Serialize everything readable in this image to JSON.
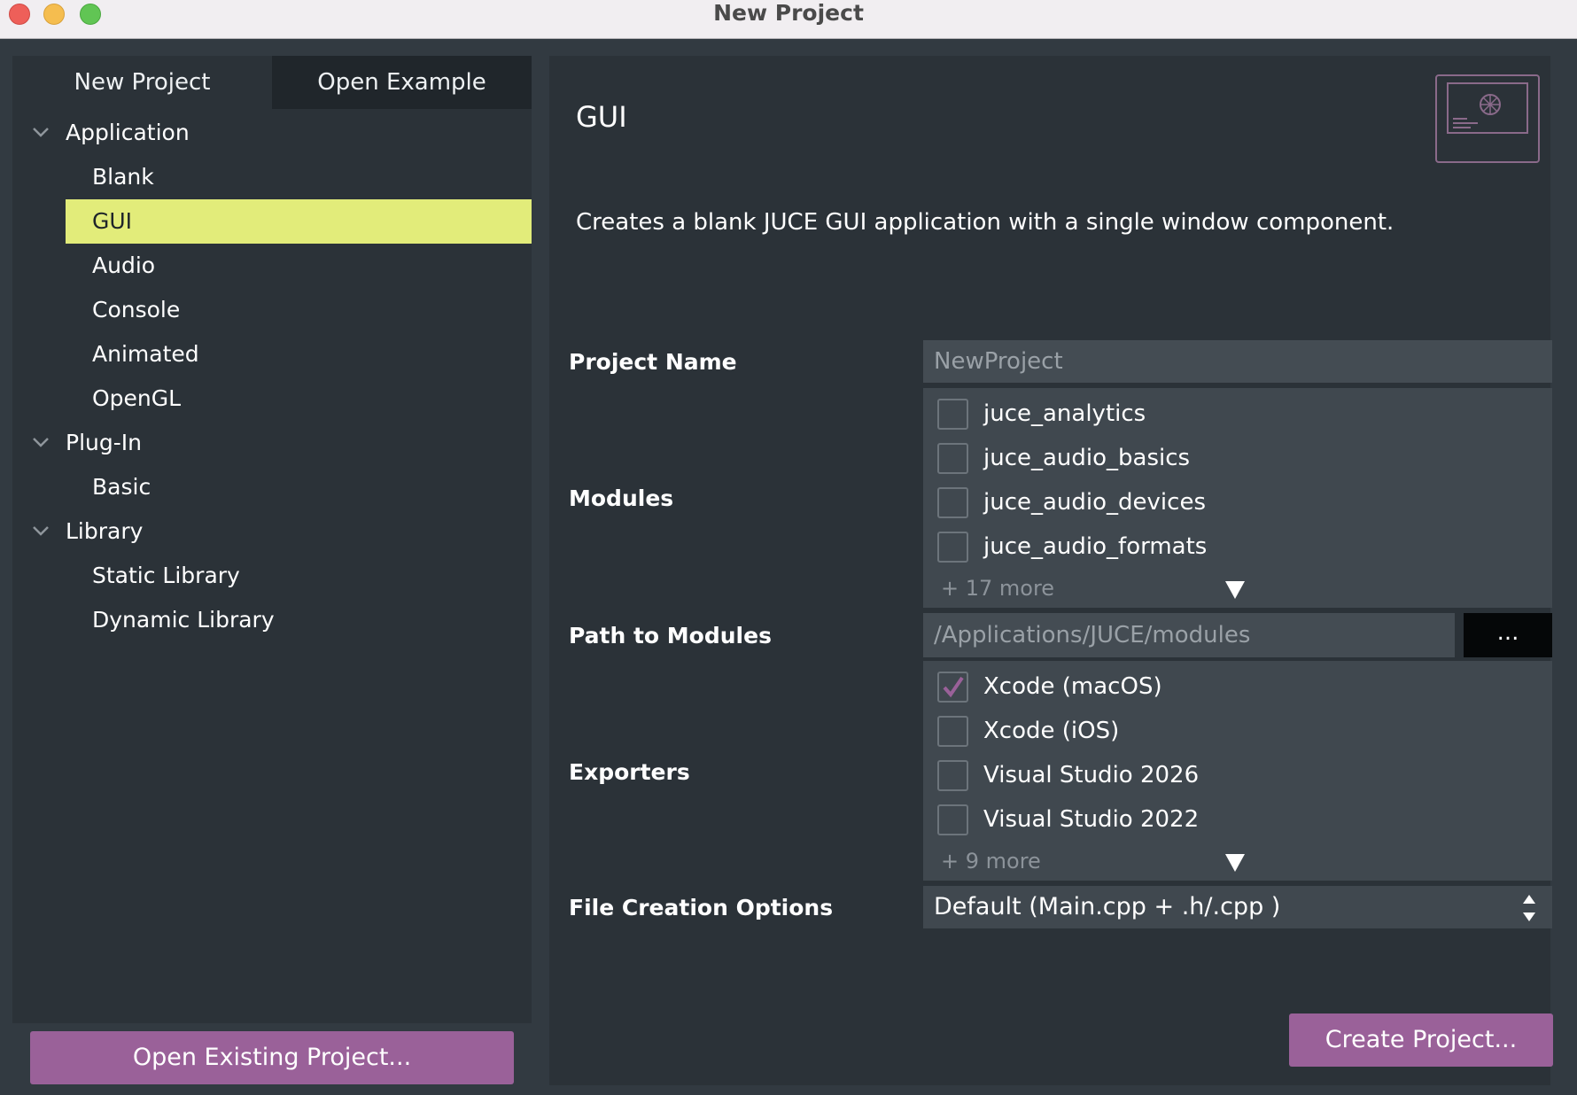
{
  "window": {
    "title": "New Project"
  },
  "tabs": [
    {
      "label": "New Project",
      "active": true
    },
    {
      "label": "Open Example",
      "active": false
    }
  ],
  "tree": {
    "groups": [
      {
        "label": "Application",
        "items": [
          "Blank",
          "GUI",
          "Audio",
          "Console",
          "Animated",
          "OpenGL"
        ]
      },
      {
        "label": "Plug-In",
        "items": [
          "Basic"
        ]
      },
      {
        "label": "Library",
        "items": [
          "Static Library",
          "Dynamic Library"
        ]
      }
    ],
    "selected": "GUI"
  },
  "open_existing_label": "Open Existing Project...",
  "template": {
    "title": "GUI",
    "description": "Creates a blank JUCE GUI application with a single window component."
  },
  "form": {
    "project_name": {
      "label": "Project Name",
      "placeholder": "NewProject",
      "value": ""
    },
    "modules": {
      "label": "Modules",
      "items": [
        {
          "name": "juce_analytics",
          "checked": false
        },
        {
          "name": "juce_audio_basics",
          "checked": false
        },
        {
          "name": "juce_audio_devices",
          "checked": false
        },
        {
          "name": "juce_audio_formats",
          "checked": false
        }
      ],
      "more": "+ 17 more"
    },
    "path_to_modules": {
      "label": "Path to Modules",
      "placeholder": "/Applications/JUCE/modules",
      "browse_label": "..."
    },
    "exporters": {
      "label": "Exporters",
      "items": [
        {
          "name": "Xcode (macOS)",
          "checked": true
        },
        {
          "name": "Xcode (iOS)",
          "checked": false
        },
        {
          "name": "Visual Studio 2026",
          "checked": false
        },
        {
          "name": "Visual Studio 2022",
          "checked": false
        }
      ],
      "more": "+ 9 more"
    },
    "file_creation": {
      "label": "File Creation Options",
      "value": "Default (Main.cpp + .h/.cpp )"
    }
  },
  "create_label": "Create Project...",
  "colors": {
    "accent": "#9a6199",
    "selection": "#e2ec7a",
    "panel": "#2b3238",
    "background": "#323a41"
  }
}
